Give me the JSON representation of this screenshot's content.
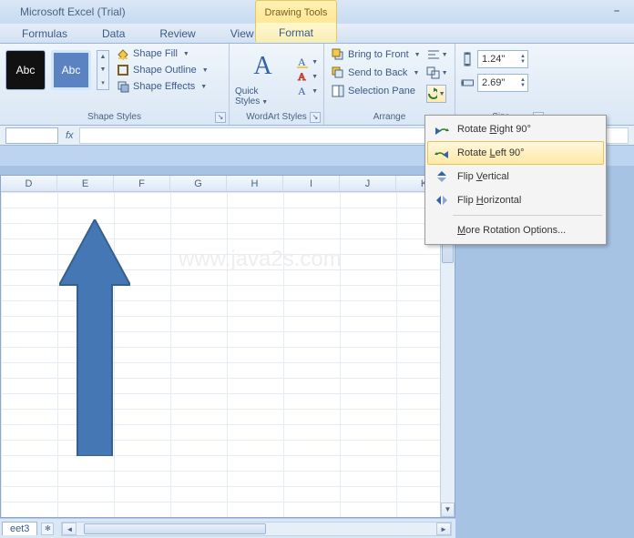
{
  "title": "Microsoft Excel (Trial)",
  "contextual_tab": "Drawing Tools",
  "tabs": {
    "formulas": "Formulas",
    "data": "Data",
    "review": "Review",
    "view": "View",
    "format": "Format"
  },
  "shape_styles": {
    "label": "Shape Styles",
    "swatch_text": "Abc",
    "fill": "Shape Fill",
    "outline": "Shape Outline",
    "effects": "Shape Effects"
  },
  "quick_styles": {
    "label": "Quick Styles",
    "group_label": "WordArt Styles"
  },
  "arrange": {
    "label": "Arrange",
    "bring_front": "Bring to Front",
    "send_back": "Send to Back",
    "selection_pane": "Selection Pane"
  },
  "size": {
    "height": "1.24\"",
    "width": "2.69\"",
    "label": "Size"
  },
  "rotate_menu": {
    "right90": "Rotate Right 90°",
    "left90": "Rotate Left 90°",
    "flipv": "Flip Vertical",
    "fliph": "Flip Horizontal",
    "more": "More Rotation Options..."
  },
  "columns": [
    "D",
    "E",
    "F",
    "G",
    "H",
    "I",
    "J",
    "K"
  ],
  "sheet_tab": "eet3",
  "watermark": "www.java2s.com",
  "fx_label": "fx"
}
